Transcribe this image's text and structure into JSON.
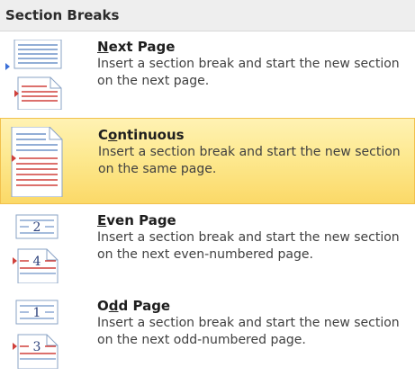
{
  "section": {
    "title": "Section Breaks"
  },
  "items": [
    {
      "title_pre": "",
      "title_mnemonic": "N",
      "title_post": "ext Page",
      "description": "Insert a section break and start the new section on the next page.",
      "icon": "next-page-break-icon"
    },
    {
      "title_pre": "C",
      "title_mnemonic": "o",
      "title_post": "ntinuous",
      "description": "Insert a section break and start the new section on the same page.",
      "icon": "continuous-break-icon"
    },
    {
      "title_pre": "",
      "title_mnemonic": "E",
      "title_post": "ven Page",
      "description": "Insert a section break and start the new section on the next even-numbered page.",
      "icon": "even-page-break-icon",
      "icon_top_number": "2",
      "icon_bottom_number": "4"
    },
    {
      "title_pre": "O",
      "title_mnemonic": "d",
      "title_post": "d Page",
      "description": "Insert a section break and start the new section on the next odd-numbered page.",
      "icon": "odd-page-break-icon",
      "icon_top_number": "1",
      "icon_bottom_number": "3"
    }
  ],
  "colors": {
    "highlight": "#fde990",
    "highlight_border": "#f1c14d",
    "page_lines_blue": "#6f93c8",
    "page_lines_red": "#d0403b",
    "marker_blue": "#3a6fd8"
  }
}
